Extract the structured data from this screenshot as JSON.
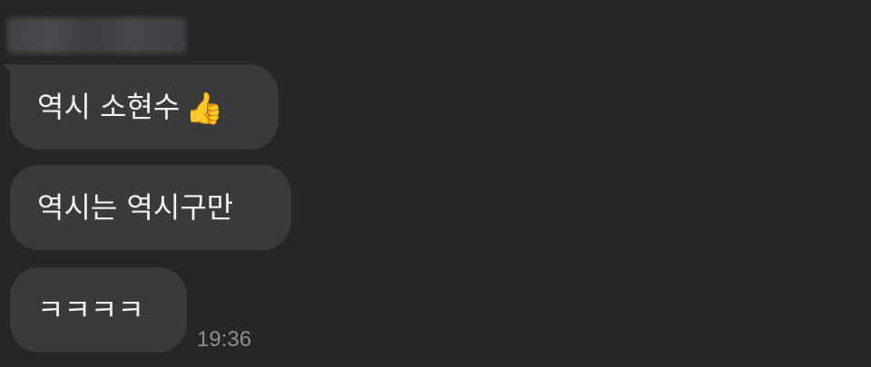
{
  "chat": {
    "messages": [
      {
        "text": "역시 소현수",
        "emoji": "👍"
      },
      {
        "text": "역시는 역시구만"
      },
      {
        "text": "ㅋㅋㅋㅋ"
      }
    ],
    "timestamp": "19:36"
  },
  "colors": {
    "background": "#262626",
    "bubble": "#3a3a3c",
    "text": "#f2f2f2",
    "timestamp": "#8e8e8e"
  },
  "icons": {
    "reaction": "thumbs-up-icon"
  }
}
